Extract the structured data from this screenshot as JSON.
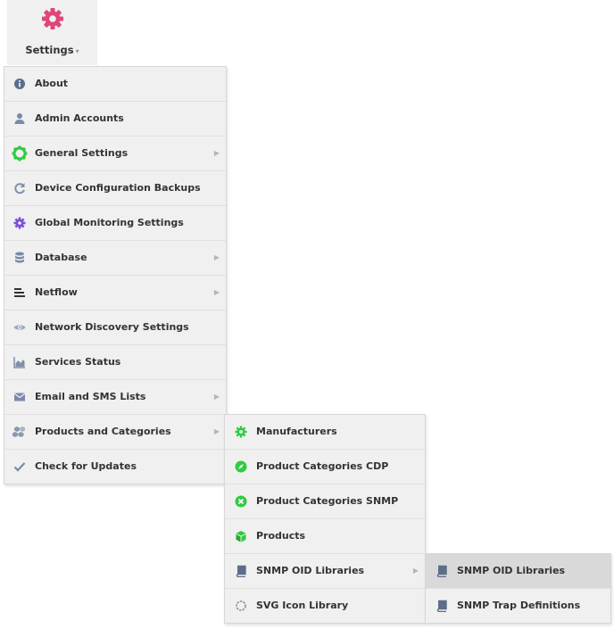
{
  "toolbar": {
    "settings_label": "Settings",
    "caret": "▾"
  },
  "colors": {
    "gear": "#e0457b",
    "info": "#3a87c9",
    "green": "#2ecc40",
    "purple": "#7b4fd8"
  },
  "settings_menu": {
    "items": [
      {
        "label": "About",
        "icon": "info-icon",
        "has_submenu": false
      },
      {
        "label": "Admin Accounts",
        "icon": "user-icon",
        "has_submenu": false
      },
      {
        "label": "General Settings",
        "icon": "gear-icon",
        "has_submenu": true
      },
      {
        "label": "Device Configuration Backups",
        "icon": "refresh-icon",
        "has_submenu": false
      },
      {
        "label": "Global Monitoring Settings",
        "icon": "cog-icon",
        "has_submenu": false
      },
      {
        "label": "Database",
        "icon": "database-icon",
        "has_submenu": true
      },
      {
        "label": "Netflow",
        "icon": "lines-icon",
        "has_submenu": true
      },
      {
        "label": "Network Discovery Settings",
        "icon": "eye-icon",
        "has_submenu": false
      },
      {
        "label": "Services Status",
        "icon": "area-chart-icon",
        "has_submenu": false
      },
      {
        "label": "Email and SMS Lists",
        "icon": "envelope-icon",
        "has_submenu": true
      },
      {
        "label": "Products and Categories",
        "icon": "cubes-icon",
        "has_submenu": true
      },
      {
        "label": "Check for Updates",
        "icon": "check-icon",
        "has_submenu": false
      }
    ],
    "arrow": "▶"
  },
  "products_submenu": {
    "items": [
      {
        "label": "Manufacturers",
        "icon": "manufacturer-icon"
      },
      {
        "label": "Product Categories CDP",
        "icon": "compass-icon"
      },
      {
        "label": "Product Categories SNMP",
        "icon": "times-circle-icon"
      },
      {
        "label": "Products",
        "icon": "cube-icon"
      },
      {
        "label": "SNMP OID Libraries",
        "icon": "book-icon"
      },
      {
        "label": "SVG Icon Library",
        "icon": "circle-notch-icon"
      }
    ]
  },
  "snmp_submenu": {
    "items": [
      {
        "label": "SNMP OID Libraries",
        "icon": "book-icon"
      },
      {
        "label": "SNMP Trap Definitions",
        "icon": "book-icon"
      }
    ]
  }
}
